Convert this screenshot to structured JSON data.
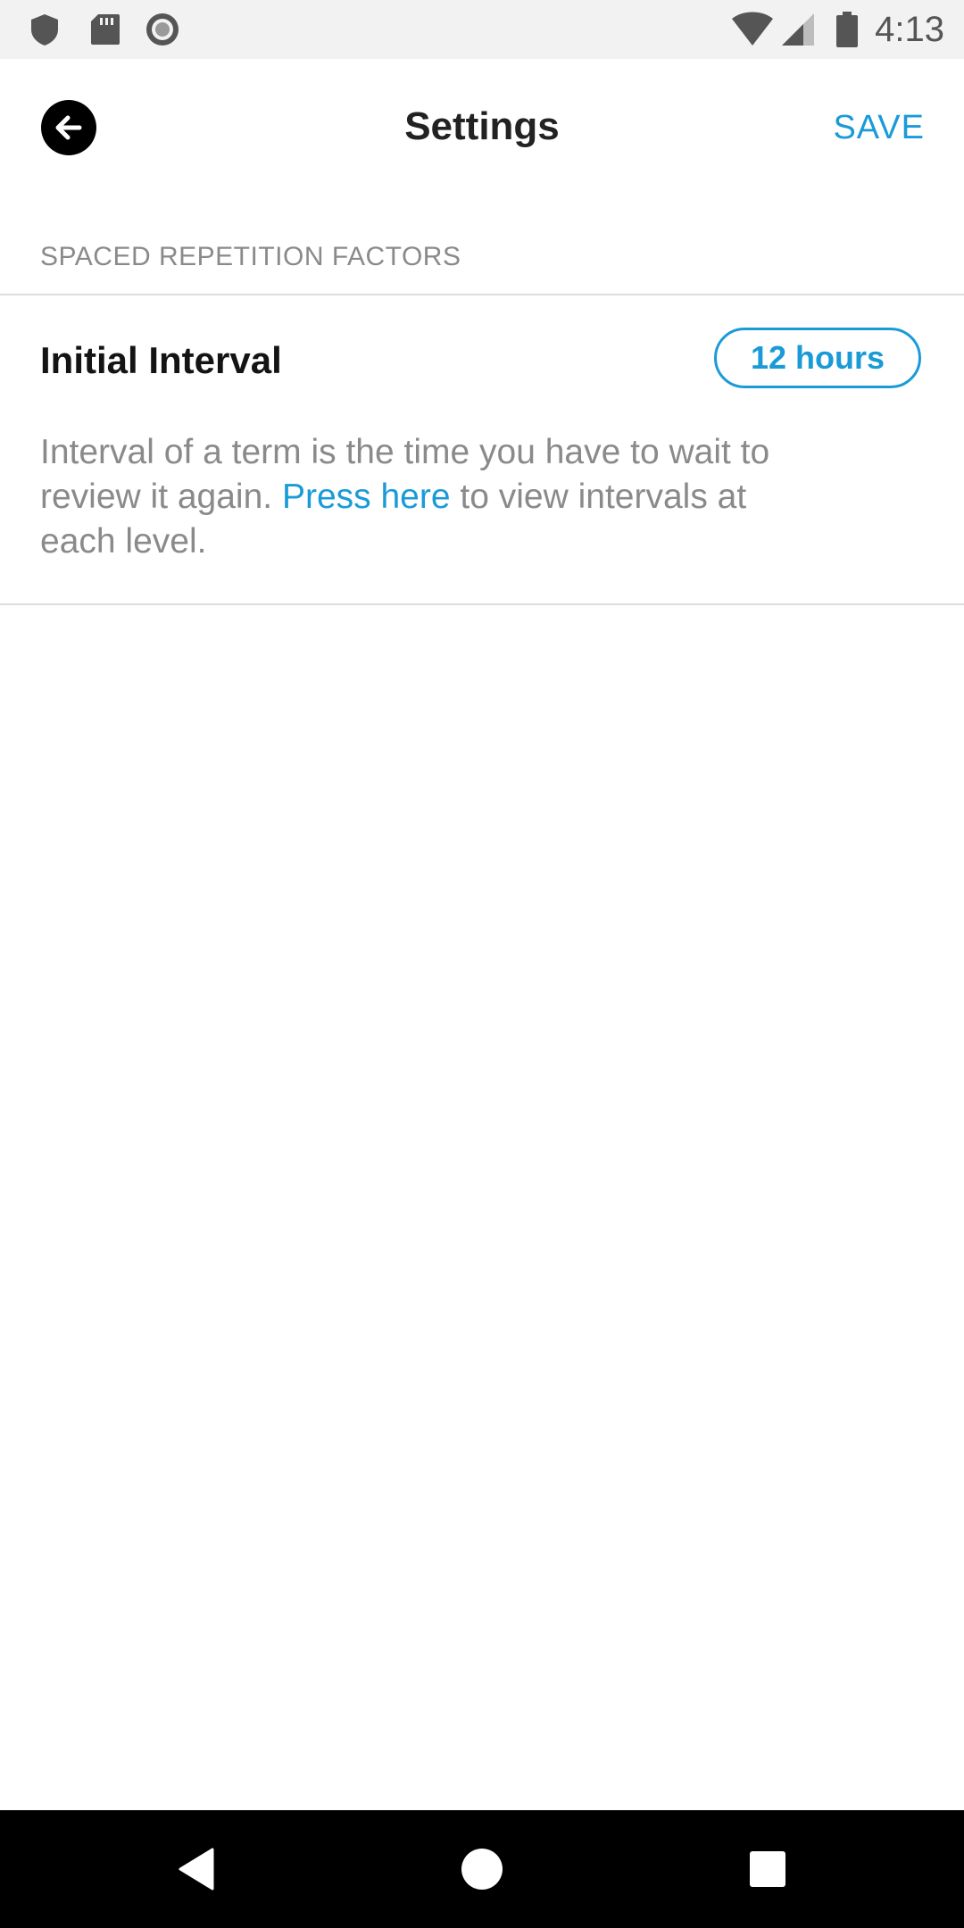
{
  "status_bar": {
    "time": "4:13",
    "left_icons": [
      "shield-icon",
      "sd-card-icon",
      "record-icon"
    ],
    "right_icons": [
      "wifi-icon",
      "cell-signal-icon",
      "battery-icon"
    ]
  },
  "app_bar": {
    "title": "Settings",
    "save_label": "SAVE",
    "back_icon": "arrow-left-icon"
  },
  "section": {
    "header": "SPACED REPETITION FACTORS"
  },
  "setting": {
    "label": "Initial Interval",
    "value": "12 hours",
    "description_before": "Interval of a term is the time you have to wait to review it again. ",
    "description_link": "Press here",
    "description_after": " to view intervals at each level."
  },
  "nav_bar": {
    "icons": [
      "back-triangle-icon",
      "home-circle-icon",
      "recents-square-icon"
    ]
  },
  "colors": {
    "accent": "#1a9bd7",
    "secondary_text": "#8a8a8a",
    "primary_text": "#141414",
    "status_bar_bg": "#f2f2f2",
    "nav_bar_bg": "#000000"
  }
}
